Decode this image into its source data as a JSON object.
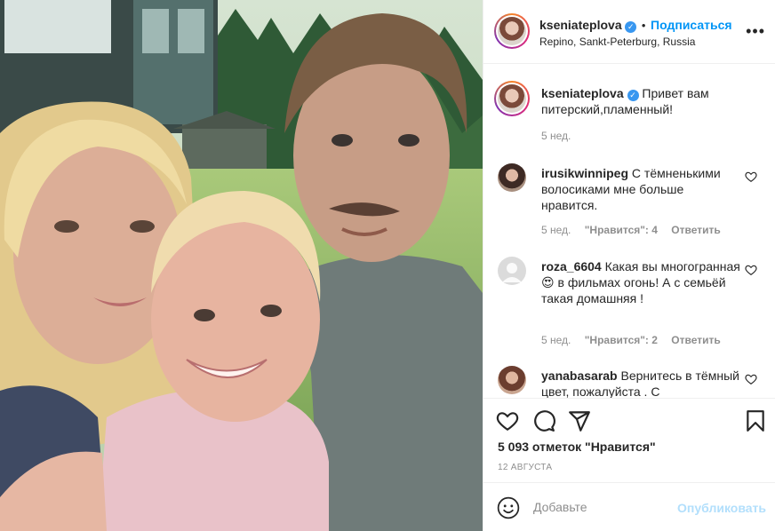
{
  "post": {
    "author": "kseniateplova",
    "follow_label": "Подписаться",
    "location": "Repino, Sankt-Peterburg, Russia",
    "more_label": "•••"
  },
  "caption": {
    "author": "kseniateplova",
    "text": "Привет вам питерский,пламенный!",
    "time": "5 нед."
  },
  "comments": [
    {
      "author": "irusikwinnipeg",
      "text": "С тёмненькими волосиками мне больше нравится.",
      "time": "5 нед.",
      "likes": "\"Нравится\": 4",
      "reply": "Ответить"
    },
    {
      "author": "roza_6604",
      "text_before": "Какая вы многогранная",
      "emoji": "😍",
      "text_after": " в фильмах огонь! А с семьёй такая домашняя !",
      "time": "5 нед.",
      "likes": "\"Нравится\": 2",
      "reply": "Ответить"
    },
    {
      "author": "yanabasarab",
      "text": "Вернитесь в тёмный цвет, пожалуйста . С"
    }
  ],
  "stats": {
    "likes": "5 093 отметок \"Нравится\"",
    "date": "12 АВГУСТА"
  },
  "composer": {
    "placeholder": "Добавьте",
    "publish_label": "Опубликовать"
  },
  "colors": {
    "accent": "#0095f6",
    "verified": "#3897f0",
    "muted": "#8e8e8e",
    "publish_disabled": "#b2dffc"
  },
  "icons": [
    "verified-badge-icon",
    "more-icon",
    "heart-icon",
    "comment-icon",
    "share-icon",
    "bookmark-icon",
    "emoji-icon"
  ]
}
